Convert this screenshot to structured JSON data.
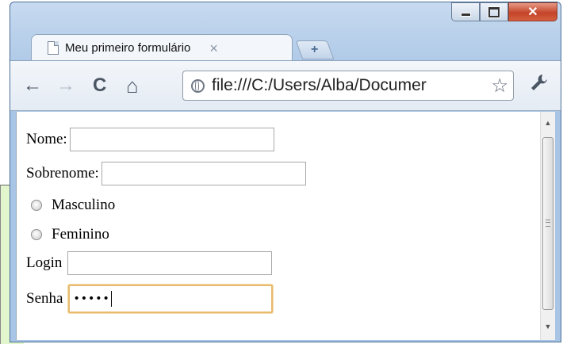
{
  "window": {
    "controls": {
      "minimize": "",
      "maximize": "",
      "close": "✕"
    }
  },
  "tab": {
    "title": "Meu primeiro formulário",
    "close_label": "×",
    "new_tab_label": "+"
  },
  "toolbar": {
    "back": "←",
    "forward": "→",
    "reload": "C",
    "home": "⌂",
    "url": "file:///C:/Users/Alba/Documer",
    "star": "☆",
    "wrench": "🔧"
  },
  "form": {
    "nome": {
      "label": "Nome:",
      "value": ""
    },
    "sobrenome": {
      "label": "Sobrenome:",
      "value": ""
    },
    "sexo_options": [
      {
        "label": "Masculino",
        "checked": false
      },
      {
        "label": "Feminino",
        "checked": false
      }
    ],
    "login": {
      "label": "Login",
      "value": ""
    },
    "senha": {
      "label": "Senha",
      "value": "•••••"
    }
  }
}
